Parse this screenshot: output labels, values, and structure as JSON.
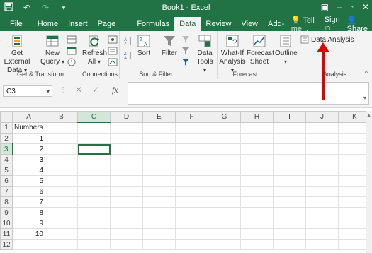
{
  "window": {
    "title": "Book1 - Excel"
  },
  "ribbon_tabs": [
    "File",
    "Home",
    "Insert",
    "Page Layout",
    "Formulas",
    "Data",
    "Review",
    "View",
    "Add-Ins"
  ],
  "tabs_right": {
    "tell_me": "Tell me...",
    "sign_in": "Sign in",
    "share": "Share"
  },
  "groups": {
    "get_transform": {
      "label": "Get & Transform",
      "get_external_data": "Get External Data",
      "new_query": "New Query"
    },
    "connections": {
      "label": "Connections",
      "refresh_all": "Refresh All"
    },
    "sort_filter": {
      "label": "Sort & Filter",
      "sort": "Sort",
      "filter": "Filter"
    },
    "data_tools": {
      "label": "Data Tools",
      "data_tools": "Data Tools"
    },
    "forecast": {
      "label": "Forecast",
      "what_if": "What-If Analysis",
      "forecast_sheet": "Forecast Sheet"
    },
    "outline": {
      "label": "",
      "outline": "Outline"
    },
    "analysis": {
      "label": "Analysis",
      "data_analysis": "Data Analysis"
    }
  },
  "formula_bar": {
    "name_box": "C3",
    "fx": "fx",
    "formula": ""
  },
  "grid": {
    "columns": [
      "A",
      "B",
      "C",
      "D",
      "E",
      "F",
      "G",
      "H",
      "I",
      "J",
      "K"
    ],
    "selected_column": "C",
    "selected_row": 3,
    "rows": [
      {
        "n": "1",
        "a": "Numbers"
      },
      {
        "n": "2",
        "a": "1"
      },
      {
        "n": "3",
        "a": "2"
      },
      {
        "n": "4",
        "a": "3"
      },
      {
        "n": "5",
        "a": "4"
      },
      {
        "n": "6",
        "a": "5"
      },
      {
        "n": "7",
        "a": "6"
      },
      {
        "n": "8",
        "a": "7"
      },
      {
        "n": "9",
        "a": "8"
      },
      {
        "n": "10",
        "a": "9"
      },
      {
        "n": "11",
        "a": "10"
      },
      {
        "n": "12",
        "a": ""
      }
    ]
  },
  "colors": {
    "excel_green": "#217346",
    "ribbon_bg": "#f3f3f3",
    "annotation_arrow": "#e30000"
  }
}
